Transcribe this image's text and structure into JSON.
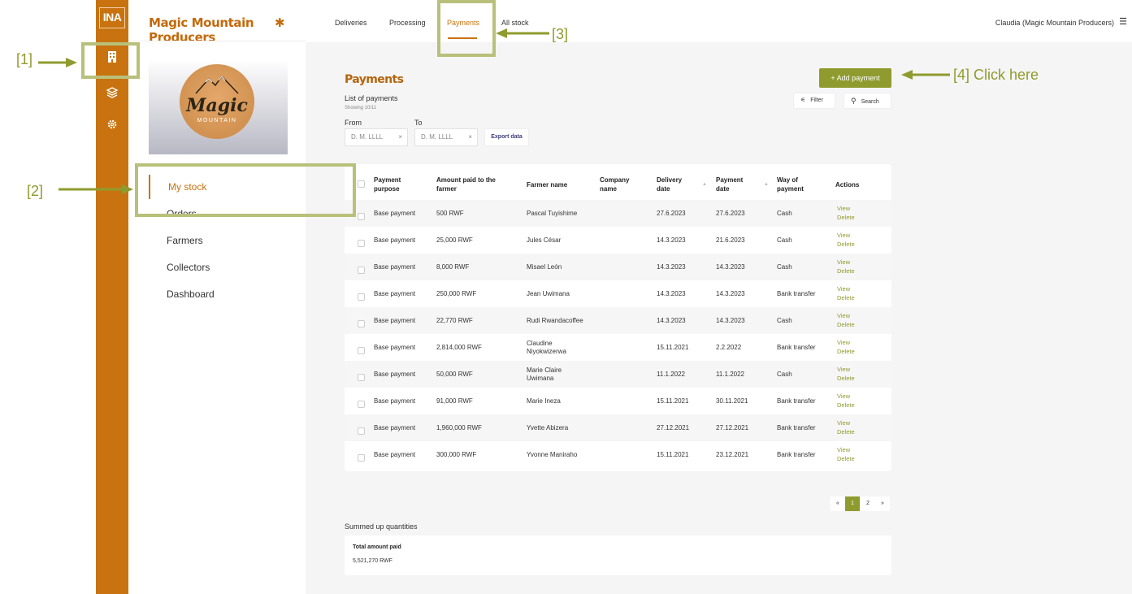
{
  "annotations": {
    "a1": "[1]",
    "a2": "[2]",
    "a3": "[3]",
    "a4": "[4] Click here"
  },
  "rail": {
    "logo": "INA",
    "icons": [
      "building-icon",
      "layers-icon",
      "gear-icon"
    ]
  },
  "sidebar": {
    "company": "Magic Mountain Producers",
    "brand_word": "Magic",
    "brand_sub": "MOUNTAIN",
    "items": [
      {
        "label": "My stock"
      },
      {
        "label": "Orders"
      },
      {
        "label": "Farmers"
      },
      {
        "label": "Collectors"
      },
      {
        "label": "Dashboard"
      }
    ]
  },
  "topbar": {
    "tabs": [
      {
        "label": "Deliveries"
      },
      {
        "label": "Processing"
      },
      {
        "label": "Payments"
      },
      {
        "label": "All stock"
      }
    ],
    "user": "Claudia (Magic Mountain Producers)"
  },
  "page": {
    "title": "Payments",
    "subtitle": "List of payments",
    "showing": "Showing 10/11",
    "from_label": "From",
    "to_label": "To",
    "from_placeholder": "D. M. LLLL",
    "to_placeholder": "D. M. LLLL",
    "export_label": "Export data",
    "add_label": "+ Add payment",
    "filter_label": "Filter",
    "search_label": "Search"
  },
  "table": {
    "headers": {
      "purpose": [
        "Payment",
        "purpose"
      ],
      "amount": [
        "Amount paid to the",
        "farmer"
      ],
      "farmer": "Farmer name",
      "company": [
        "Company",
        "name"
      ],
      "delivery": [
        "Delivery",
        "date"
      ],
      "payment": [
        "Payment",
        "date"
      ],
      "way": [
        "Way of",
        "payment"
      ],
      "actions": "Actions"
    },
    "view_label": "View",
    "delete_label": "Delete",
    "rows": [
      {
        "purpose": "Base payment",
        "amount": "500 RWF",
        "farmer": [
          "Pascal Tuyishime"
        ],
        "company": "",
        "delivery": "27.6.2023",
        "payment": "27.6.2023",
        "way": "Cash"
      },
      {
        "purpose": "Base payment",
        "amount": "25,000 RWF",
        "farmer": [
          "Jules César"
        ],
        "company": "",
        "delivery": "14.3.2023",
        "payment": "21.6.2023",
        "way": "Cash"
      },
      {
        "purpose": "Base payment",
        "amount": "8,000 RWF",
        "farmer": [
          "Misael León"
        ],
        "company": "",
        "delivery": "14.3.2023",
        "payment": "14.3.2023",
        "way": "Cash"
      },
      {
        "purpose": "Base payment",
        "amount": "250,000 RWF",
        "farmer": [
          "Jean Uwimana"
        ],
        "company": "",
        "delivery": "14.3.2023",
        "payment": "14.3.2023",
        "way": "Bank transfer"
      },
      {
        "purpose": "Base payment",
        "amount": "22,770 RWF",
        "farmer": [
          "Rudi Rwandacoffee"
        ],
        "company": "",
        "delivery": "14.3.2023",
        "payment": "14.3.2023",
        "way": "Cash"
      },
      {
        "purpose": "Base payment",
        "amount": "2,814,000 RWF",
        "farmer": [
          "Claudine",
          "Niyokwizerwa"
        ],
        "company": "",
        "delivery": "15.11.2021",
        "payment": "2.2.2022",
        "way": "Bank transfer"
      },
      {
        "purpose": "Base payment",
        "amount": "50,000 RWF",
        "farmer": [
          "Marie Claire",
          "Uwimana"
        ],
        "company": "",
        "delivery": "11.1.2022",
        "payment": "11.1.2022",
        "way": "Cash"
      },
      {
        "purpose": "Base payment",
        "amount": "91,000 RWF",
        "farmer": [
          "Marie Ineza"
        ],
        "company": "",
        "delivery": "15.11.2021",
        "payment": "30.11.2021",
        "way": "Bank transfer"
      },
      {
        "purpose": "Base payment",
        "amount": "1,960,000 RWF",
        "farmer": [
          "Yvette Abizera"
        ],
        "company": "",
        "delivery": "27.12.2021",
        "payment": "27.12.2021",
        "way": "Bank transfer"
      },
      {
        "purpose": "Base payment",
        "amount": "300,000 RWF",
        "farmer": [
          "Yvonne Maniraho"
        ],
        "company": "",
        "delivery": "15.11.2021",
        "payment": "23.12.2021",
        "way": "Bank transfer"
      }
    ]
  },
  "pagination": {
    "prev": "«",
    "pages": [
      "1",
      "2"
    ],
    "current": "1",
    "next": "»"
  },
  "summary": {
    "title": "Summed up quantities",
    "label": "Total amount paid",
    "value": "5,521,270 RWF"
  },
  "colors": {
    "rail": "#c8730f",
    "accent": "#8f9b2e",
    "annotation": "#b8c07a"
  }
}
